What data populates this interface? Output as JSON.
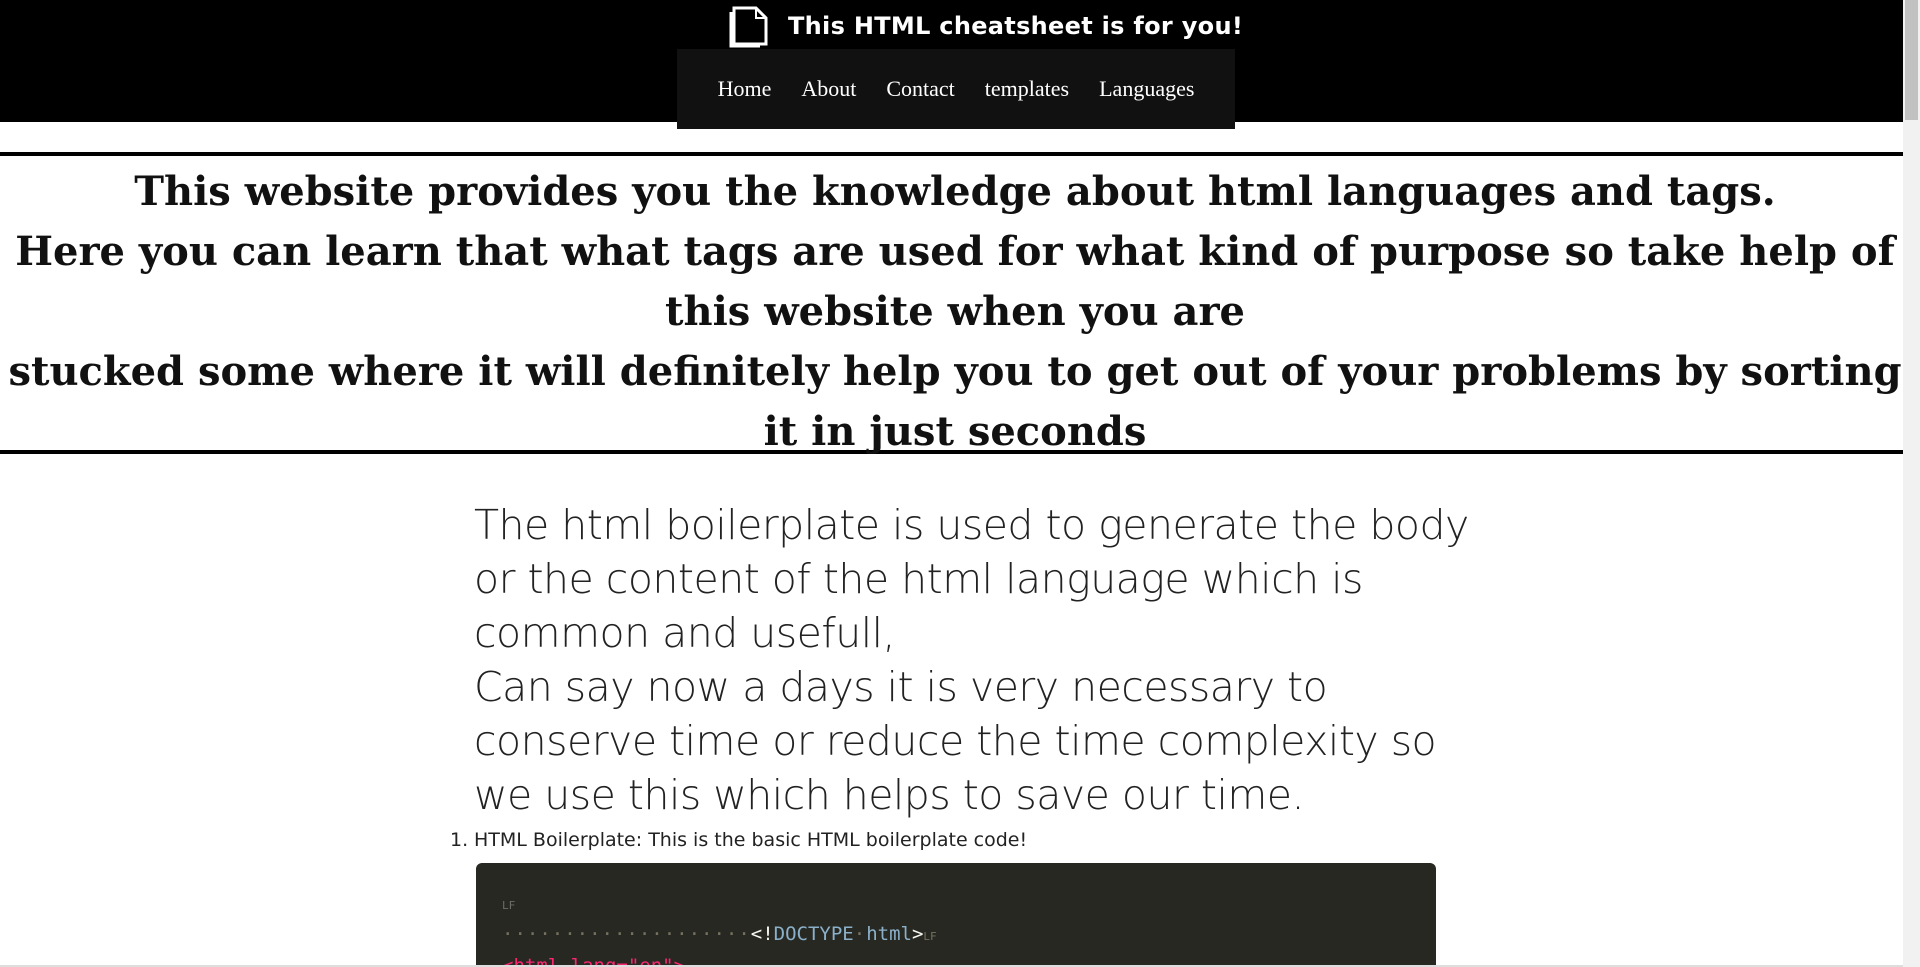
{
  "header": {
    "title": "This HTML cheatsheet is for you!",
    "logo_icon": "document-icon",
    "nav": [
      {
        "label": "Home"
      },
      {
        "label": "About"
      },
      {
        "label": "Contact"
      },
      {
        "label": "templates"
      },
      {
        "label": "Languages"
      }
    ]
  },
  "intro": {
    "line1": "This website provides you the knowledge about html languages and tags.",
    "line2": "Here you can learn that what tags are used for what kind of purpose so take help of this website when you are",
    "line3": "stucked some where it will definitely help you to get out of your problems by sorting it in just seconds"
  },
  "main": {
    "lead_part1": "The html boilerplate is used to generate the body or the content of the html language which is common and usefull,",
    "lead_part2": "Can say now a days it is very necessary to conserve time or reduce the time complexity so we use this which helps to save our time.",
    "list": [
      {
        "number": "1.",
        "text": "HTML Boilerplate: This is the basic HTML boilerplate code!"
      }
    ],
    "code": {
      "lf_marker": "LF",
      "indent_dots": "····················",
      "doctype_open": "<!",
      "doctype_kw": "DOCTYPE",
      "doctype_space": "·",
      "doctype_html": "html",
      "doctype_close": ">",
      "line3_partial": "<html lang=\"en\">"
    }
  },
  "colors": {
    "header_bg": "#000000",
    "code_bg": "#272822"
  }
}
